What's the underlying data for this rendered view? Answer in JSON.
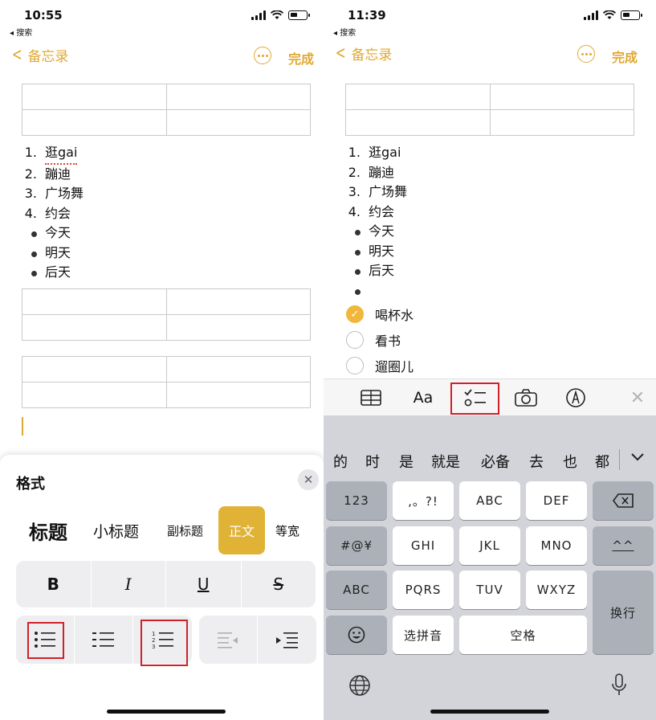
{
  "left": {
    "status": {
      "time": "10:55",
      "back_app": "◂ 搜索"
    },
    "nav": {
      "back_label": "备忘录",
      "done_label": "完成"
    },
    "numbered_items": [
      {
        "marker": "1.",
        "text": "逛gai"
      },
      {
        "marker": "2.",
        "text": "蹦迪"
      },
      {
        "marker": "3.",
        "text": "广场舞"
      },
      {
        "marker": "4.",
        "text": "约会"
      }
    ],
    "bullet_items": [
      "今天",
      "明天",
      "后天"
    ],
    "format_panel": {
      "title": "格式",
      "close_icon": "✕",
      "styles": [
        "标题",
        "小标题",
        "副标题",
        "正文",
        "等宽"
      ],
      "selected_style": "正文",
      "text_styles": [
        "B",
        "I",
        "U",
        "S"
      ],
      "list_icons": [
        "bulleted-list-icon",
        "dashed-list-icon",
        "numbered-list-icon",
        "outdent-icon",
        "indent-icon"
      ]
    }
  },
  "right": {
    "status": {
      "time": "11:39",
      "back_app": "◂ 搜索"
    },
    "nav": {
      "back_label": "备忘录",
      "done_label": "完成"
    },
    "numbered_items": [
      {
        "marker": "1.",
        "text": "逛gai"
      },
      {
        "marker": "2.",
        "text": "蹦迪"
      },
      {
        "marker": "3.",
        "text": "广场舞"
      },
      {
        "marker": "4.",
        "text": "约会"
      }
    ],
    "bullet_items": [
      "今天",
      "明天",
      "后天",
      ""
    ],
    "checklist": [
      {
        "text": "喝杯水",
        "checked": true
      },
      {
        "text": "看书",
        "checked": false
      },
      {
        "text": "遛圈儿",
        "checked": false
      }
    ],
    "toolbar": {
      "format_label": "Aa"
    },
    "keyboard": {
      "candidates": [
        "的",
        "时",
        "是",
        "就是",
        "必备",
        "去",
        "也",
        "都"
      ],
      "row1": [
        "123",
        ",。?!",
        "ABC",
        "DEF"
      ],
      "row2": [
        "#@¥",
        "GHI",
        "JKL",
        "MNO",
        "^^"
      ],
      "row3": [
        "ABC",
        "PQRS",
        "TUV",
        "WXYZ"
      ],
      "row4": [
        "选拼音",
        "空格"
      ],
      "return_label": "换行"
    }
  },
  "colors": {
    "accent": "#e0a832",
    "highlight_box": "#d0202a",
    "selected_style_bg": "#e0b337"
  }
}
